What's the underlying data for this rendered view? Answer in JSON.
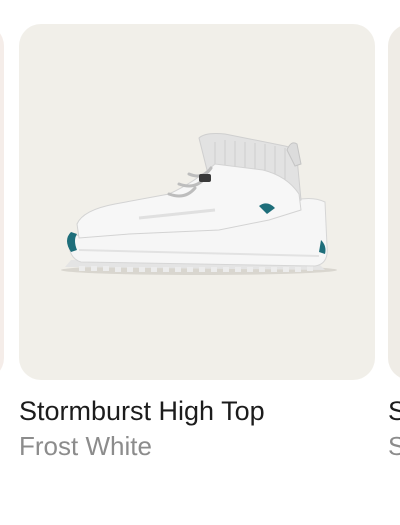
{
  "products": [
    {
      "name": "",
      "color": ""
    },
    {
      "name": "Stormburst High Top",
      "color": "Frost White",
      "image_icon": "high-top-sneaker-icon"
    },
    {
      "name": "S",
      "color": "S"
    }
  ],
  "colors": {
    "card_background": "#f1efe9",
    "name_text": "#1c1c1c",
    "color_text": "#8c8c8c",
    "accent_teal": "#1e6e7a"
  }
}
